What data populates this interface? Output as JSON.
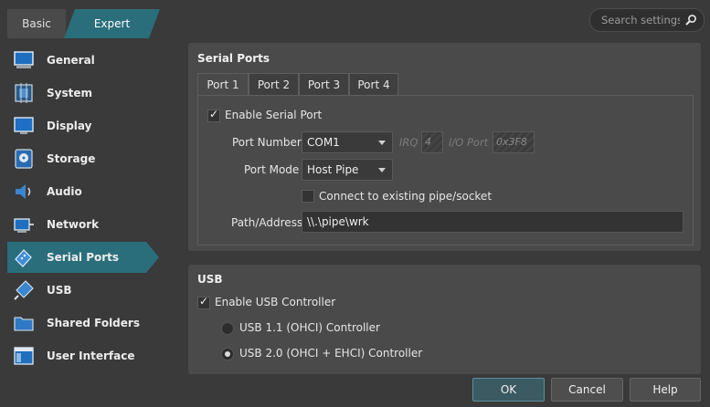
{
  "mode": {
    "basic": "Basic",
    "expert": "Expert",
    "selected": "Expert"
  },
  "search": {
    "placeholder": "Search settings"
  },
  "sidebar": {
    "items": [
      {
        "label": "General",
        "icon": "general-icon"
      },
      {
        "label": "System",
        "icon": "system-icon"
      },
      {
        "label": "Display",
        "icon": "display-icon"
      },
      {
        "label": "Storage",
        "icon": "storage-icon"
      },
      {
        "label": "Audio",
        "icon": "audio-icon"
      },
      {
        "label": "Network",
        "icon": "network-icon"
      },
      {
        "label": "Serial Ports",
        "icon": "serial-ports-icon",
        "active": true
      },
      {
        "label": "USB",
        "icon": "usb-icon"
      },
      {
        "label": "Shared Folders",
        "icon": "shared-folders-icon"
      },
      {
        "label": "User Interface",
        "icon": "user-interface-icon"
      }
    ]
  },
  "serial": {
    "title": "Serial Ports",
    "tabs": [
      "Port 1",
      "Port 2",
      "Port 3",
      "Port 4"
    ],
    "active_tab": "Port 1",
    "enable_label": "Enable Serial Port",
    "enable_checked": true,
    "port_number_label": "Port Number",
    "port_number_value": "COM1",
    "irq_label": "IRQ",
    "irq_value": "4",
    "io_port_label": "I/O Port",
    "io_port_value": "0x3F8",
    "port_mode_label": "Port Mode",
    "port_mode_value": "Host Pipe",
    "connect_existing_label": "Connect to existing pipe/socket",
    "connect_existing_checked": false,
    "path_label": "Path/Address",
    "path_value": "\\\\.\\pipe\\wrk"
  },
  "usb": {
    "title": "USB",
    "enable_label": "Enable USB Controller",
    "enable_checked": true,
    "options": [
      "USB 1.1 (OHCI) Controller",
      "USB 2.0 (OHCI + EHCI) Controller"
    ],
    "selected_option": "USB 2.0 (OHCI + EHCI) Controller"
  },
  "buttons": {
    "ok": "OK",
    "cancel": "Cancel",
    "help": "Help"
  },
  "colors": {
    "accent": "#2a6e7b",
    "background": "#3a3a3a",
    "panel": "#4a4a4a"
  }
}
